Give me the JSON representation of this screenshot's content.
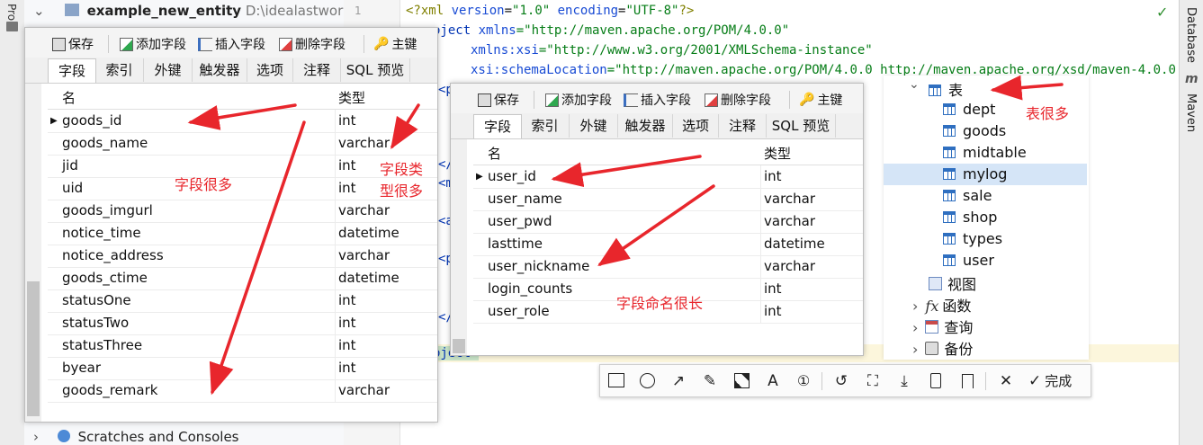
{
  "project": {
    "module_name": "example_new_entity",
    "module_path": "D:\\idealastwork\\exa",
    "scratches_label": "Scratches and Consoles",
    "left_strip_label": "Pro",
    "line_number": "1"
  },
  "right_strip": {
    "database_label": "Database",
    "maven_label": "Maven"
  },
  "editor": {
    "lines": [
      {
        "pre": "<?xml ",
        "a1": "version",
        "eq1": "=",
        "v1": "\"1.0\"",
        "a2": " encoding",
        "eq2": "=",
        "v2": "\"UTF-8\"",
        "post": "?>"
      },
      {
        "tag": "oject ",
        "a": "xmlns",
        "v": "=\"http://maven.apache.org/POM/4.0.0\""
      },
      {
        "a": "xmlns:xsi",
        "v": "=\"http://www.w3.org/2001/XMLSchema-instance\""
      },
      {
        "a": "xsi:schemaLocation",
        "v": "=\"http://maven.apache.org/POM/4.0.0 http://maven.apache.org/xsd/maven-4.0.0.xsd\">"
      }
    ],
    "fragments": [
      "<pa",
      "</",
      "<mo",
      "<ar",
      "<pr",
      "</p",
      "oject>"
    ]
  },
  "window1": {
    "toolbar": {
      "save": "保存",
      "add_field": "添加字段",
      "insert_field": "插入字段",
      "delete_field": "删除字段",
      "primary_key": "主键"
    },
    "tabs": [
      "字段",
      "索引",
      "外键",
      "触发器",
      "选项",
      "注释",
      "SQL 预览"
    ],
    "columns": {
      "name": "名",
      "type": "类型"
    },
    "rows": [
      {
        "name": "goods_id",
        "type": "int"
      },
      {
        "name": "goods_name",
        "type": "varchar"
      },
      {
        "name": "jid",
        "type": "int"
      },
      {
        "name": "uid",
        "type": "int"
      },
      {
        "name": "goods_imgurl",
        "type": "varchar"
      },
      {
        "name": "notice_time",
        "type": "datetime"
      },
      {
        "name": "notice_address",
        "type": "varchar"
      },
      {
        "name": "goods_ctime",
        "type": "datetime"
      },
      {
        "name": "statusOne",
        "type": "int"
      },
      {
        "name": "statusTwo",
        "type": "int"
      },
      {
        "name": "statusThree",
        "type": "int"
      },
      {
        "name": "byear",
        "type": "int"
      },
      {
        "name": "goods_remark",
        "type": "varchar"
      }
    ]
  },
  "window2": {
    "toolbar": {
      "save": "保存",
      "add_field": "添加字段",
      "insert_field": "插入字段",
      "delete_field": "删除字段",
      "primary_key": "主键"
    },
    "tabs": [
      "字段",
      "索引",
      "外键",
      "触发器",
      "选项",
      "注释",
      "SQL 预览"
    ],
    "columns": {
      "name": "名",
      "type": "类型"
    },
    "rows": [
      {
        "name": "user_id",
        "type": "int"
      },
      {
        "name": "user_name",
        "type": "varchar"
      },
      {
        "name": "user_pwd",
        "type": "varchar"
      },
      {
        "name": "lasttime",
        "type": "datetime"
      },
      {
        "name": "user_nickname",
        "type": "varchar"
      },
      {
        "name": "login_counts",
        "type": "int"
      },
      {
        "name": "user_role",
        "type": "int"
      }
    ]
  },
  "tree": {
    "tables_label": "表",
    "tables": [
      "dept",
      "goods",
      "midtable",
      "mylog",
      "sale",
      "shop",
      "types",
      "user"
    ],
    "selected": "mylog",
    "views_label": "视图",
    "functions_label": "函数",
    "queries_label": "查询",
    "backups_label": "备份"
  },
  "annotations": {
    "many_fields": "字段很多",
    "many_types_line1": "字段类",
    "many_types_line2": "型很多",
    "long_names": "字段命名很长",
    "many_tables": "表很多",
    "accent_color": "#e8262c"
  },
  "annotation_toolbar": {
    "icons": [
      "rectangle-icon",
      "circle-icon",
      "arrow-icon",
      "pen-icon",
      "mosaic-icon",
      "text-icon",
      "number-icon",
      "undo-icon",
      "crop-icon",
      "download-icon",
      "pin-icon",
      "bookmark-icon",
      "close-icon",
      "check-icon"
    ],
    "done_label": "完成"
  }
}
